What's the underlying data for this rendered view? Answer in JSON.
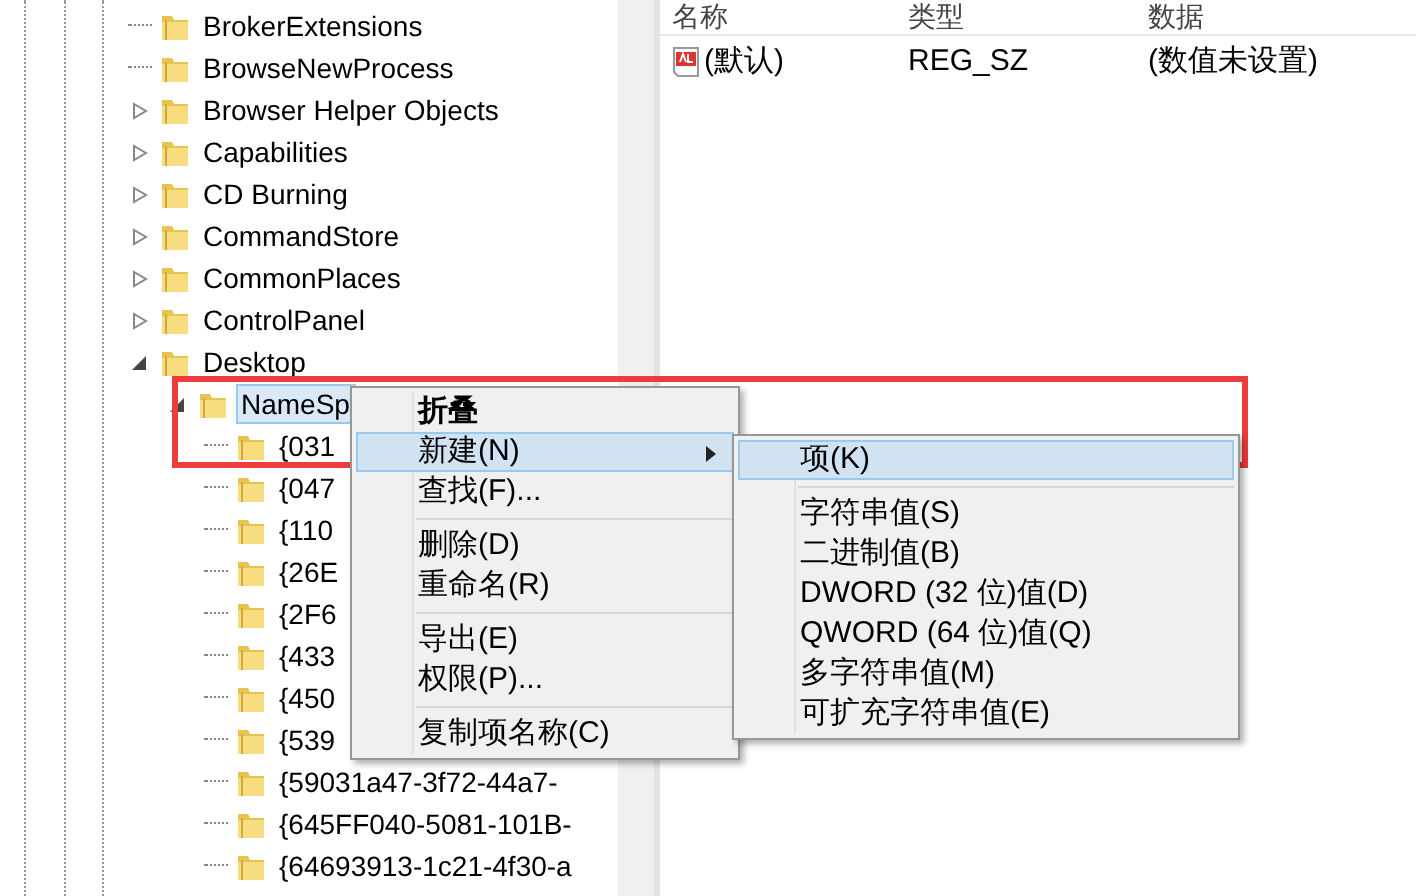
{
  "tree": [
    {
      "label": "BrokerExtensions",
      "kind": "leaf",
      "selected": false
    },
    {
      "label": "BrowseNewProcess",
      "kind": "leaf",
      "selected": false
    },
    {
      "label": "Browser Helper Objects",
      "kind": "branch",
      "expanded": false,
      "selected": false
    },
    {
      "label": "Capabilities",
      "kind": "branch",
      "expanded": false,
      "selected": false
    },
    {
      "label": "CD Burning",
      "kind": "branch",
      "expanded": false,
      "selected": false
    },
    {
      "label": "CommandStore",
      "kind": "branch",
      "expanded": false,
      "selected": false
    },
    {
      "label": "CommonPlaces",
      "kind": "branch",
      "expanded": false,
      "selected": false
    },
    {
      "label": "ControlPanel",
      "kind": "branch",
      "expanded": false,
      "selected": false
    },
    {
      "label": "Desktop",
      "kind": "branch",
      "expanded": true,
      "selected": false,
      "children": [
        {
          "label": "NameSp",
          "kind": "branch",
          "expanded": true,
          "selected": true,
          "children": [
            {
              "label": "{031",
              "kind": "leaf",
              "selected": false
            },
            {
              "label": "{047",
              "kind": "leaf",
              "selected": false
            },
            {
              "label": "{110",
              "kind": "leaf",
              "selected": false
            },
            {
              "label": "{26E",
              "kind": "leaf",
              "selected": false
            },
            {
              "label": "{2F6",
              "kind": "leaf",
              "selected": false
            },
            {
              "label": "{433",
              "kind": "leaf",
              "selected": false
            },
            {
              "label": "{450",
              "kind": "leaf",
              "selected": false
            },
            {
              "label": "{539",
              "kind": "leaf",
              "selected": false
            },
            {
              "label": "{59031a47-3f72-44a7-",
              "kind": "leaf",
              "selected": false
            },
            {
              "label": "{645FF040-5081-101B-",
              "kind": "leaf",
              "selected": false
            },
            {
              "label": "{64693913-1c21-4f30-a",
              "kind": "leaf",
              "selected": false
            }
          ]
        }
      ]
    }
  ],
  "values": {
    "columns": [
      "名称",
      "类型",
      "数据"
    ],
    "rows": [
      {
        "name": "(默认)",
        "type": "REG_SZ",
        "data": "(数值未设置)"
      }
    ]
  },
  "context_menu": {
    "items": [
      {
        "kind": "item",
        "label": "折叠",
        "bold": true,
        "selected": false,
        "submenu": false
      },
      {
        "kind": "item",
        "label": "新建(N)",
        "bold": false,
        "selected": true,
        "submenu": true
      },
      {
        "kind": "item",
        "label": "查找(F)...",
        "bold": false,
        "selected": false,
        "submenu": false
      },
      {
        "kind": "separator"
      },
      {
        "kind": "item",
        "label": "删除(D)",
        "bold": false,
        "selected": false,
        "submenu": false
      },
      {
        "kind": "item",
        "label": "重命名(R)",
        "bold": false,
        "selected": false,
        "submenu": false
      },
      {
        "kind": "separator"
      },
      {
        "kind": "item",
        "label": "导出(E)",
        "bold": false,
        "selected": false,
        "submenu": false
      },
      {
        "kind": "item",
        "label": "权限(P)...",
        "bold": false,
        "selected": false,
        "submenu": false
      },
      {
        "kind": "separator"
      },
      {
        "kind": "item",
        "label": "复制项名称(C)",
        "bold": false,
        "selected": false,
        "submenu": false
      }
    ]
  },
  "submenu": {
    "items": [
      {
        "kind": "item",
        "label": "项(K)",
        "selected": true
      },
      {
        "kind": "separator"
      },
      {
        "kind": "item",
        "label": "字符串值(S)",
        "selected": false
      },
      {
        "kind": "item",
        "label": "二进制值(B)",
        "selected": false
      },
      {
        "kind": "item",
        "label": "DWORD (32 位)值(D)",
        "selected": false
      },
      {
        "kind": "item",
        "label": "QWORD (64 位)值(Q)",
        "selected": false
      },
      {
        "kind": "item",
        "label": "多字符串值(M)",
        "selected": false
      },
      {
        "kind": "item",
        "label": "可扩充字符串值(E)",
        "selected": false
      }
    ]
  }
}
